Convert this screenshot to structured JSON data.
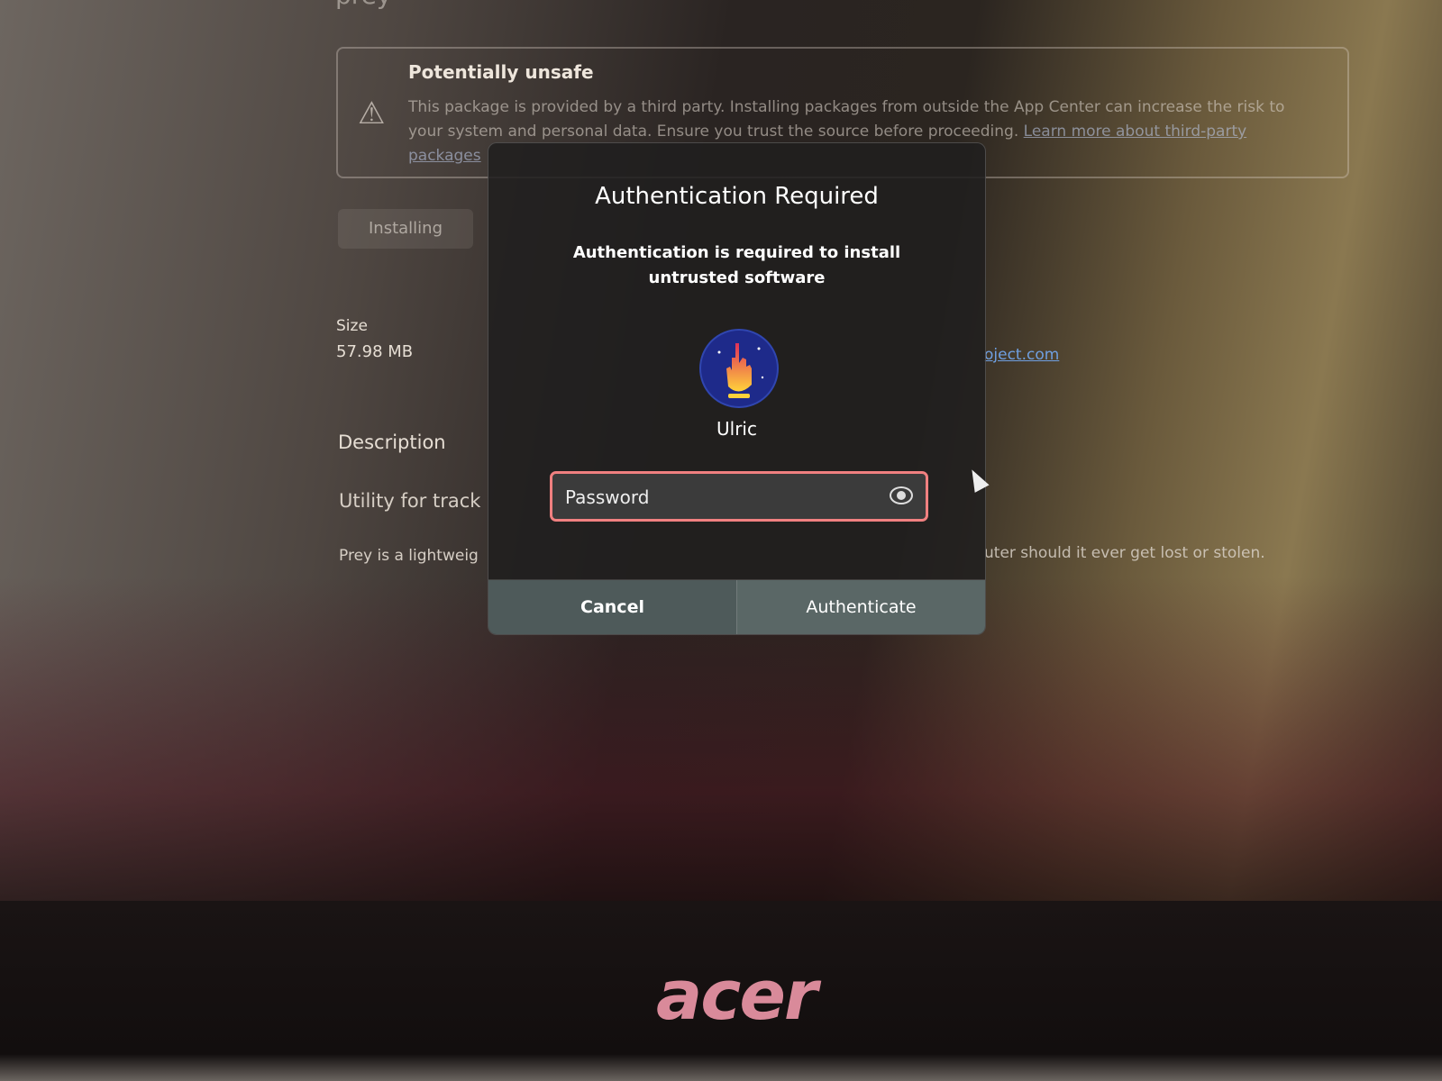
{
  "app": {
    "title": "prey",
    "warning": {
      "title": "Potentially unsafe",
      "text": "This package is provided by a third party. Installing packages from outside the App Center can increase the risk to your system and personal data. Ensure you trust the source before proceeding.",
      "link": "Learn more about third-party packages"
    },
    "install_button": "Installing",
    "size_label": "Size",
    "size_value": "57.98 MB",
    "description_heading": "Description",
    "description_summary": "Utility for track",
    "description_body_left": "Prey is a lightweig",
    "description_body_right": "uter should it ever get lost or stolen.",
    "website_link": "oject.com"
  },
  "dialog": {
    "title": "Authentication Required",
    "message": "Authentication is required to install untrusted software",
    "user": "Ulric",
    "password_placeholder": "Password",
    "cancel": "Cancel",
    "authenticate": "Authenticate"
  },
  "hardware": {
    "brand": "acer"
  }
}
